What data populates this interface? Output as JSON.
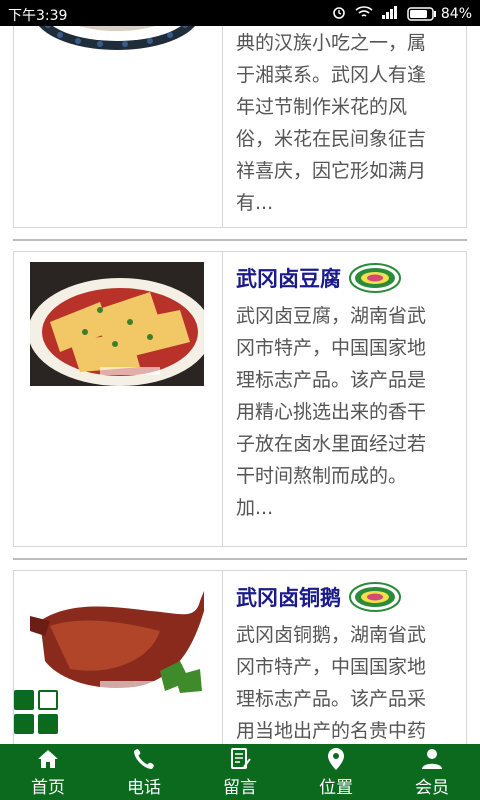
{
  "status": {
    "time": "下午3:39",
    "battery": "84%"
  },
  "cards": [
    {
      "title": "",
      "desc_lines": [
        "典的汉族小吃之一，属",
        "于湘菜系。武冈人有逢",
        "年过节制作米花的风",
        "俗，米花在民间象征吉",
        "祥喜庆，因它形如满月",
        "有..."
      ]
    },
    {
      "title": "武冈卤豆腐",
      "desc_lines": [
        "武冈卤豆腐，湖南省武",
        "冈市特产，中国国家地",
        "理标志产品。该产品是",
        "用精心挑选出来的香干",
        "子放在卤水里面经过若",
        "干时间熬制而成的。",
        "加..."
      ]
    },
    {
      "title": "武冈卤铜鹅",
      "desc_lines": [
        "武冈卤铜鹅，湖南省武",
        "冈市特产，中国国家地",
        "理标志产品。该产品采",
        "用当地出产的名贵中药"
      ]
    }
  ],
  "nav": [
    {
      "label": "首页",
      "icon": "home-icon"
    },
    {
      "label": "电话",
      "icon": "phone-icon"
    },
    {
      "label": "留言",
      "icon": "message-icon"
    },
    {
      "label": "位置",
      "icon": "location-icon"
    },
    {
      "label": "会员",
      "icon": "user-icon"
    }
  ],
  "colors": {
    "nav_bg": "#0b6a1e",
    "title": "#1a1a8c",
    "text": "#555555"
  }
}
